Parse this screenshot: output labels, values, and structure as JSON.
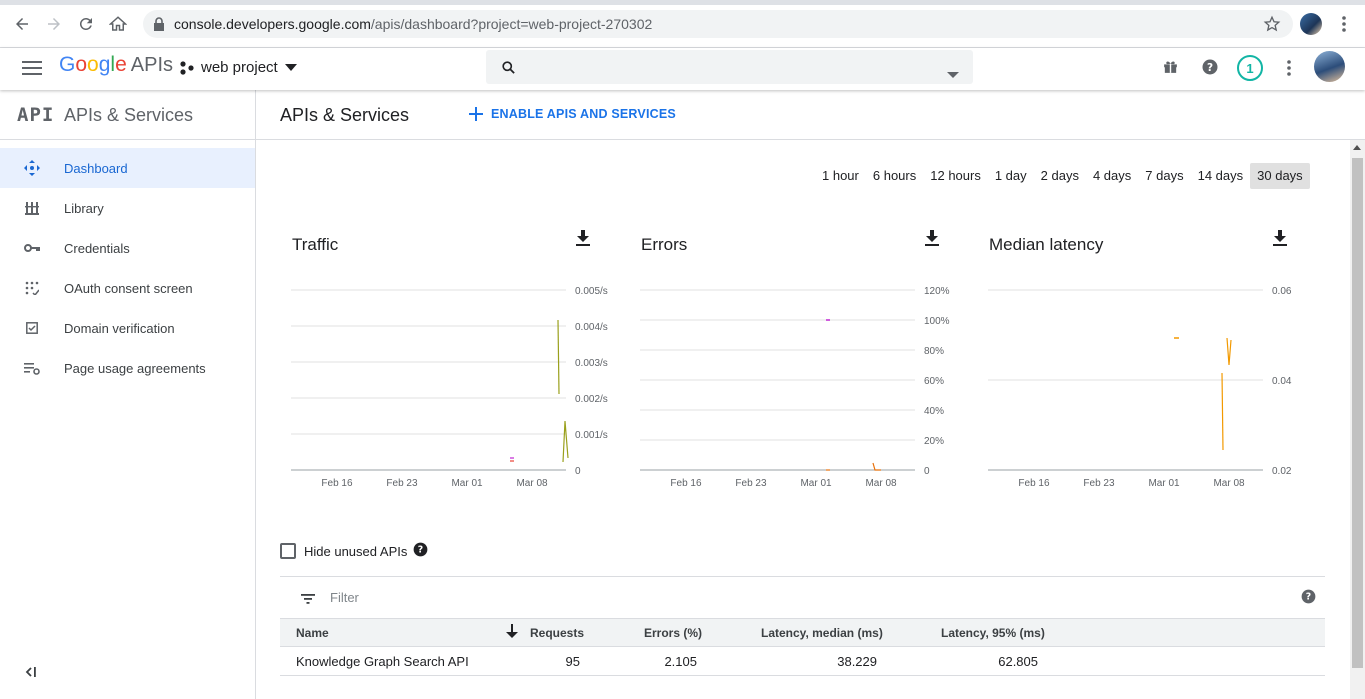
{
  "browser": {
    "url_host": "console.developers.google.com",
    "url_path": "/apis/dashboard?project=web-project-270302"
  },
  "appbar": {
    "logo_google": "Google",
    "logo_apis": "APIs",
    "project_name": "web project",
    "notification_count": "1"
  },
  "sidebar": {
    "header_mark": "API",
    "header_title": "APIs & Services",
    "items": [
      {
        "label": "Dashboard",
        "icon": "dashboard-icon",
        "active": true
      },
      {
        "label": "Library",
        "icon": "library-icon",
        "active": false
      },
      {
        "label": "Credentials",
        "icon": "key-icon",
        "active": false
      },
      {
        "label": "OAuth consent screen",
        "icon": "oauth-icon",
        "active": false
      },
      {
        "label": "Domain verification",
        "icon": "checkbox-icon",
        "active": false
      },
      {
        "label": "Page usage agreements",
        "icon": "settings-list-icon",
        "active": false
      }
    ],
    "collapse_label": "<|"
  },
  "main": {
    "title": "APIs & Services",
    "enable_button": "ENABLE APIS AND SERVICES",
    "time_ranges": [
      "1 hour",
      "6 hours",
      "12 hours",
      "1 day",
      "2 days",
      "4 days",
      "7 days",
      "14 days",
      "30 days"
    ],
    "selected_range": "30 days",
    "hide_unused_label": "Hide unused APIs",
    "filter_placeholder": "Filter"
  },
  "colors": {
    "accent_blue": "#1a73e8",
    "traffic_line": "#9aa01c",
    "error_marker": "#c026d3",
    "latency_line": "#f29900"
  },
  "chart_data": [
    {
      "type": "line",
      "title": "Traffic",
      "x_ticks": [
        "Feb 16",
        "Feb 23",
        "Mar 01",
        "Mar 08"
      ],
      "y_ticks": [
        "0",
        "0.001/s",
        "0.002/s",
        "0.003/s",
        "0.004/s",
        "0.005/s"
      ],
      "ylim": [
        0,
        0.005
      ]
    },
    {
      "type": "line",
      "title": "Errors",
      "x_ticks": [
        "Feb 16",
        "Feb 23",
        "Mar 01",
        "Mar 08"
      ],
      "y_ticks": [
        "0",
        "20%",
        "40%",
        "60%",
        "80%",
        "100%",
        "120%"
      ],
      "ylim": [
        0,
        120
      ]
    },
    {
      "type": "line",
      "title": "Median latency",
      "x_ticks": [
        "Feb 16",
        "Feb 23",
        "Mar 01",
        "Mar 08"
      ],
      "y_ticks": [
        "0.02",
        "0.04",
        "0.06"
      ],
      "ylim": [
        0.02,
        0.06
      ]
    }
  ],
  "table": {
    "columns": [
      "Name",
      "Requests",
      "Errors (%)",
      "Latency, median (ms)",
      "Latency, 95% (ms)"
    ],
    "rows": [
      {
        "name": "Knowledge Graph Search API",
        "requests": "95",
        "errors": "2.105",
        "latency_median": "38.229",
        "latency_95": "62.805"
      }
    ]
  }
}
